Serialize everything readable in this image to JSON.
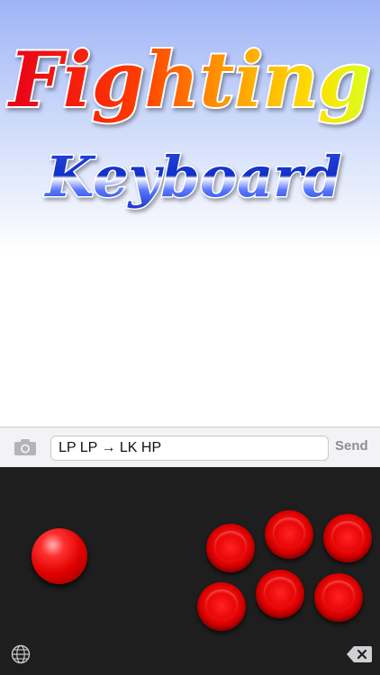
{
  "logo": {
    "line1": "Fighting",
    "line2": "Keyboard"
  },
  "compose": {
    "input_value": "LP LP → LK HP",
    "send_label": "Send",
    "camera_icon": "camera-icon"
  },
  "keyboard": {
    "joystick": "joystick",
    "buttons": [
      "punch-1",
      "punch-2",
      "punch-3",
      "kick-1",
      "kick-2",
      "kick-3"
    ],
    "globe_icon": "globe-icon",
    "delete_icon": "delete-icon"
  },
  "colors": {
    "button_red": "#e00000",
    "keyboard_bg": "#1e1e1e",
    "compose_bg": "#f3f3f5",
    "send_disabled": "#8e8e93"
  }
}
